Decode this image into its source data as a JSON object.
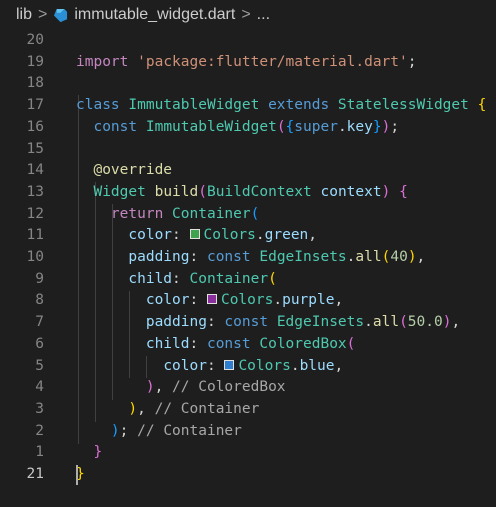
{
  "breadcrumb": {
    "folder": "lib",
    "separator": ">",
    "file": "immutable_widget.dart",
    "ellipsis": "..."
  },
  "colors": {
    "background": "#1e1e1e",
    "green_swatch": "#3fa34d",
    "purple_swatch": "#8b2f9d",
    "blue_swatch": "#2f7fd0"
  },
  "editor": {
    "active_line": "21",
    "lines": [
      {
        "n": "20",
        "text": "import 'package:flutter/material.dart';"
      },
      {
        "n": "19",
        "text": ""
      },
      {
        "n": "18",
        "text": "class ImmutableWidget extends StatelessWidget {"
      },
      {
        "n": "17",
        "text": "  const ImmutableWidget({super.key});"
      },
      {
        "n": "16",
        "text": ""
      },
      {
        "n": "15",
        "text": "  @override"
      },
      {
        "n": "14",
        "text": "  Widget build(BuildContext context) {"
      },
      {
        "n": "13",
        "text": "    return Container("
      },
      {
        "n": "12",
        "text": "      color: Colors.green,"
      },
      {
        "n": "11",
        "text": "      padding: const EdgeInsets.all(40),"
      },
      {
        "n": "10",
        "text": "      child: Container("
      },
      {
        "n": "9",
        "text": "        color: Colors.purple,"
      },
      {
        "n": "8",
        "text": "        padding: const EdgeInsets.all(50.0),"
      },
      {
        "n": "7",
        "text": "        child: const ColoredBox("
      },
      {
        "n": "6",
        "text": "          color: Colors.blue,"
      },
      {
        "n": "5",
        "text": "        ), // ColoredBox"
      },
      {
        "n": "4",
        "text": "      ), // Container"
      },
      {
        "n": "3",
        "text": "    ); // Container"
      },
      {
        "n": "2",
        "text": "  }"
      },
      {
        "n": "1",
        "text": "}"
      },
      {
        "n": "21",
        "text": ""
      }
    ]
  }
}
